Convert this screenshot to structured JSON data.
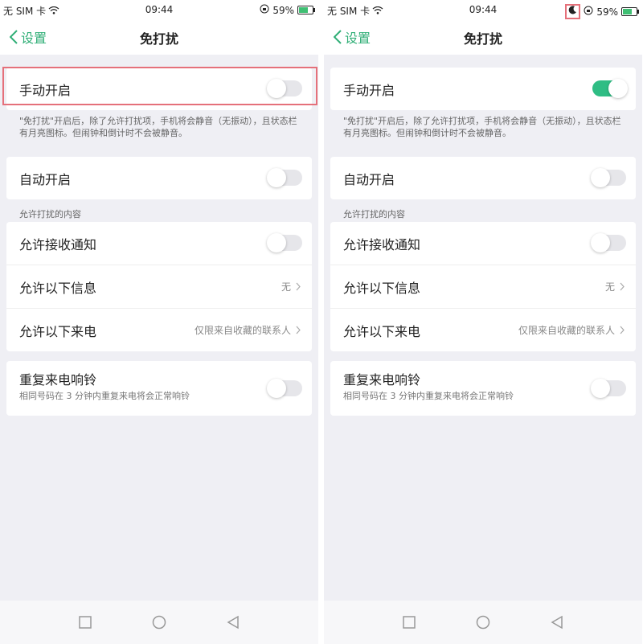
{
  "status": {
    "carrier": "无 SIM 卡",
    "time": "09:44",
    "battery": "59%",
    "moon": "🌙"
  },
  "nav": {
    "back_label": "设置",
    "title": "免打扰"
  },
  "manual": {
    "label": "手动开启"
  },
  "description": "\"免打扰\"开启后，除了允许打扰项，手机将会静音（无振动），且状态栏有月亮图标。但闹钟和倒计时不会被静音。",
  "auto": {
    "label": "自动开启"
  },
  "allowed_section": "允许打扰的内容",
  "allowed": [
    {
      "label": "允许接收通知",
      "value": ""
    },
    {
      "label": "允许以下信息",
      "value": "无"
    },
    {
      "label": "允许以下来电",
      "value": "仅限来自收藏的联系人"
    }
  ],
  "repeat": {
    "label": "重复来电响铃",
    "sub": "相同号码在 3 分钟内重复来电将会正常响铃"
  },
  "colors": {
    "accent": "#2fbd84",
    "highlight": "#e5707a"
  },
  "toggle_states": {
    "left_manual": false,
    "right_manual": true
  }
}
